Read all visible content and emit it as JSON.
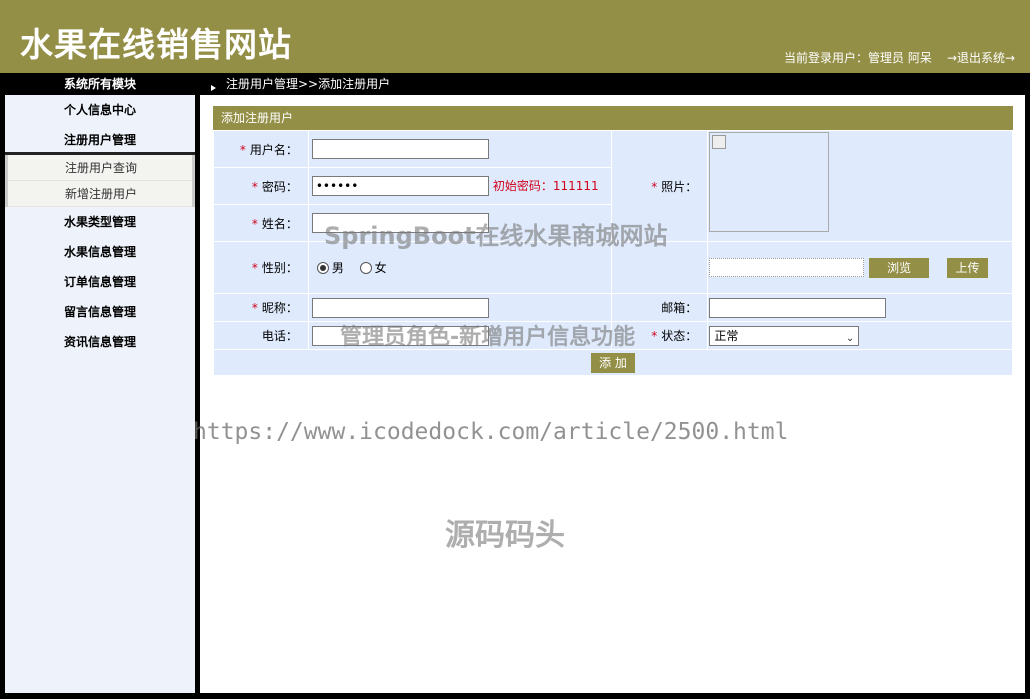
{
  "header": {
    "title": "水果在线销售网站",
    "user_info": "当前登录用户：管理员 阿呆",
    "logout": "→退出系统→"
  },
  "bar": {
    "left_title": "系统所有模块",
    "breadcrumb": "注册用户管理>>添加注册用户"
  },
  "sidebar": {
    "items": [
      {
        "label": "个人信息中心"
      },
      {
        "label": "注册用户管理"
      },
      {
        "label": "水果类型管理"
      },
      {
        "label": "水果信息管理"
      },
      {
        "label": "订单信息管理"
      },
      {
        "label": "留言信息管理"
      },
      {
        "label": "资讯信息管理"
      }
    ],
    "submenu": [
      {
        "label": "注册用户查询"
      },
      {
        "label": "新增注册用户"
      }
    ]
  },
  "panel": {
    "title": "添加注册用户"
  },
  "form": {
    "required_mark": "*",
    "username_label": "用户名：",
    "username_value": "",
    "password_label": "密码：",
    "password_value": "••••••",
    "password_hint": "初始密码：111111",
    "photo_label": "照片：",
    "name_label": "姓名：",
    "name_value": "",
    "gender_label": "性别：",
    "gender_options": [
      "男",
      "女"
    ],
    "browse_label": "浏览",
    "upload_label": "上传",
    "nickname_label": "昵称：",
    "nickname_value": "",
    "email_label": "邮箱：",
    "email_value": "",
    "phone_label": "电话：",
    "phone_value": "",
    "status_label": "状态：",
    "status_value": "正常",
    "submit_label": "添 加"
  },
  "watermarks": {
    "line1": "SpringBoot在线水果商城网站",
    "line2": "管理员角色-新增用户信息功能",
    "line3": "https://www.icodedock.com/article/2500.html",
    "line4": "源码码头"
  }
}
